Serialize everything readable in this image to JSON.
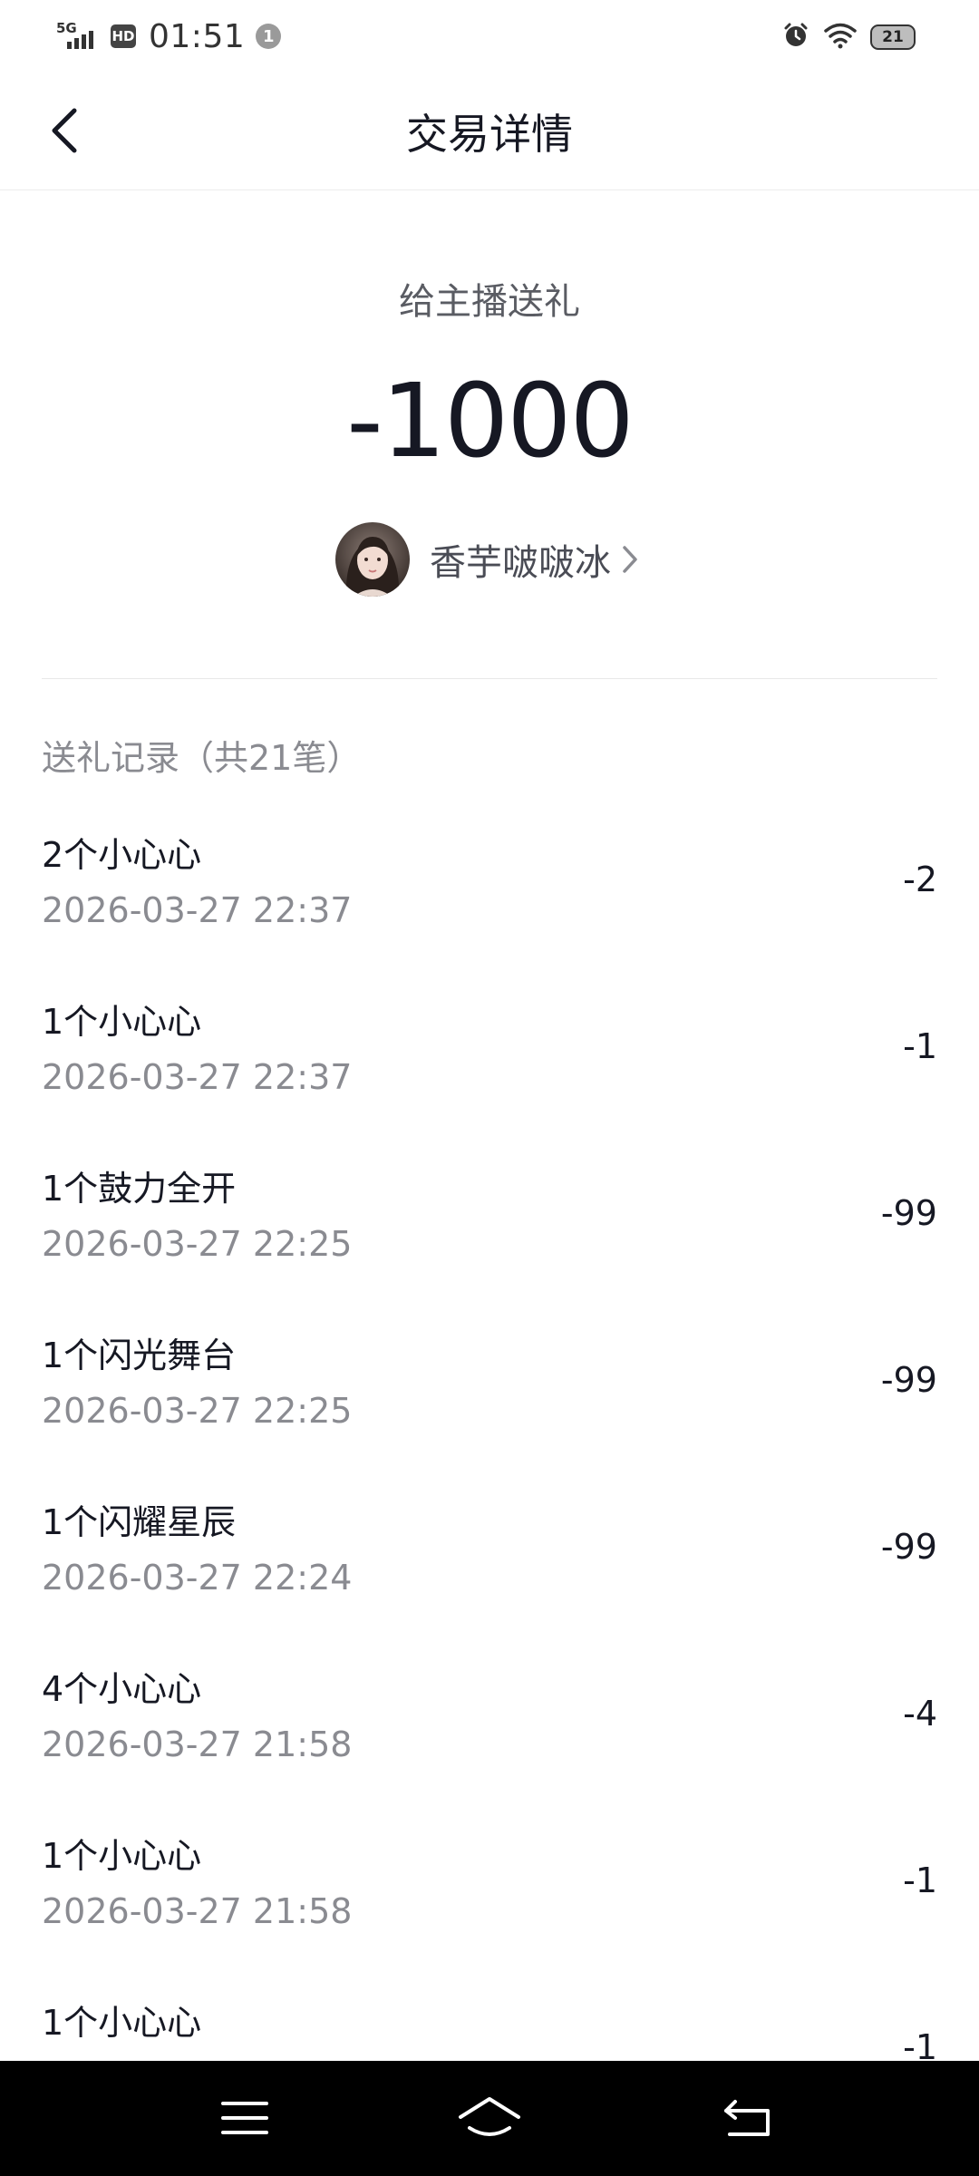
{
  "status_bar": {
    "network": "5G",
    "hd": "HD",
    "time": "01:51",
    "notification_count": "1",
    "battery": "21"
  },
  "nav": {
    "title": "交易详情"
  },
  "summary": {
    "type": "给主播送礼",
    "amount": "-1000",
    "streamer_name": "香芋啵啵冰"
  },
  "records": {
    "title": "送礼记录（共21笔）",
    "items": [
      {
        "gift": "2个小心心",
        "date": "2026-03-27 22:37",
        "amount": "-2"
      },
      {
        "gift": "1个小心心",
        "date": "2026-03-27 22:37",
        "amount": "-1"
      },
      {
        "gift": "1个鼓力全开",
        "date": "2026-03-27 22:25",
        "amount": "-99"
      },
      {
        "gift": "1个闪光舞台",
        "date": "2026-03-27 22:25",
        "amount": "-99"
      },
      {
        "gift": "1个闪耀星辰",
        "date": "2026-03-27 22:24",
        "amount": "-99"
      },
      {
        "gift": "4个小心心",
        "date": "2026-03-27 21:58",
        "amount": "-4"
      },
      {
        "gift": "1个小心心",
        "date": "2026-03-27 21:58",
        "amount": "-1"
      },
      {
        "gift": "1个小心心",
        "date": "",
        "amount": "-1"
      }
    ]
  },
  "icons": {
    "back": "chevron-left-icon",
    "streamer_link": "chevron-right-icon",
    "menu": "menu-icon",
    "home": "home-icon",
    "back_system": "back-icon"
  },
  "colors": {
    "text_primary": "#161823",
    "text_secondary": "#8a8b91",
    "system_nav_bg": "#000000"
  }
}
